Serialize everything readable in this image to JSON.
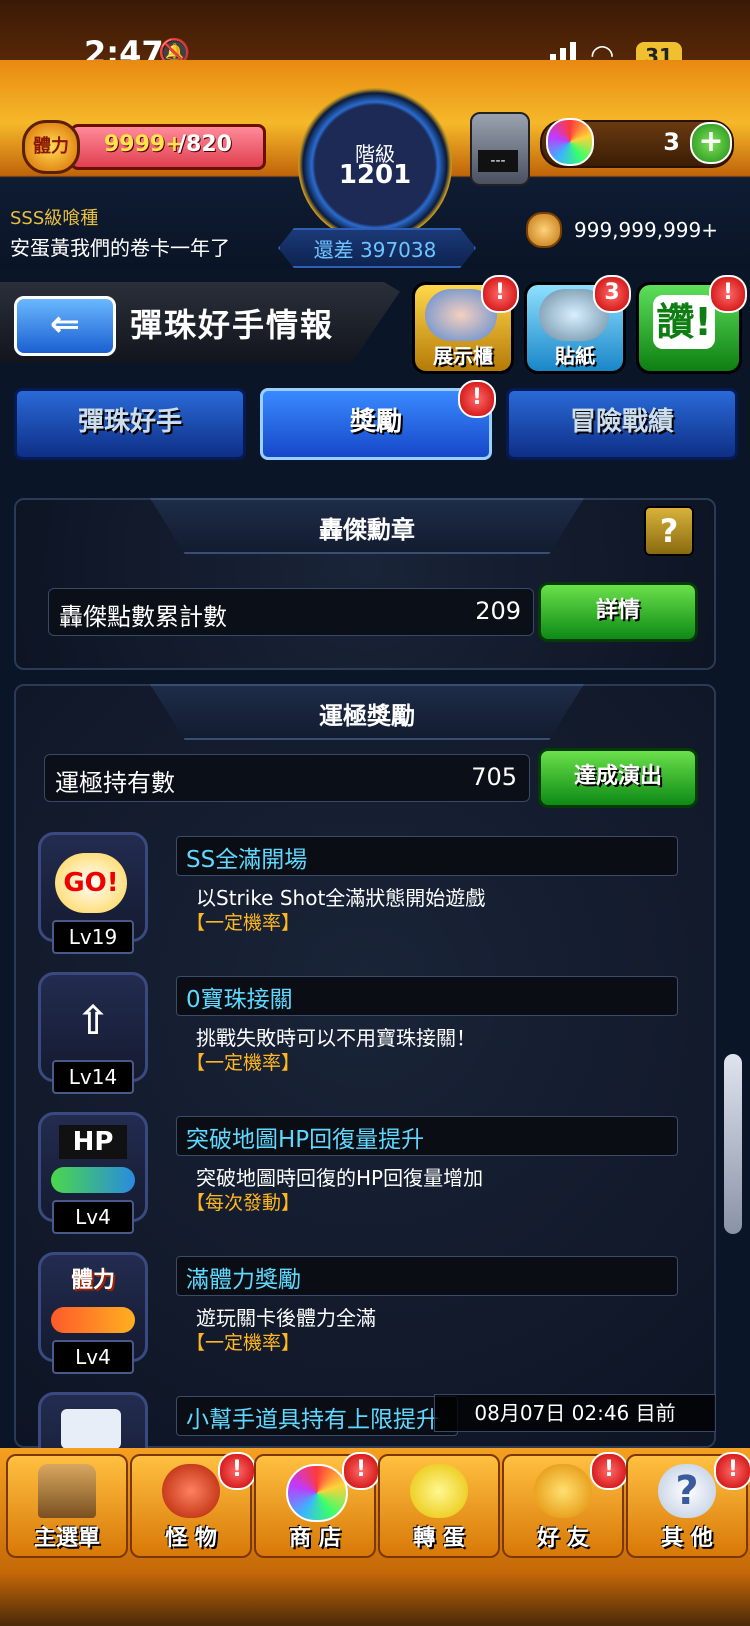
{
  "status_bar": {
    "time": "2:47",
    "battery": "31"
  },
  "header": {
    "stamina_icon_label": "體力",
    "stamina_current": "9999+",
    "stamina_max": "/820",
    "rank_label": "階級",
    "rank_value": "1201",
    "exp_remaining": "還差 397038",
    "gem_machine_label": "---",
    "orb_count": "3",
    "add_symbol": "+",
    "player_title": "SSS級喰種",
    "player_name": "安蛋黃我們的卷卡一年了",
    "coin_count": "999,999,999+"
  },
  "title_bar": {
    "back_symbol": "⇐",
    "title": "彈珠好手情報",
    "buttons": [
      {
        "label": "展示櫃",
        "badge": "!"
      },
      {
        "label": "貼紙",
        "badge": "3"
      },
      {
        "label": "讚!",
        "badge": "!"
      }
    ]
  },
  "tabs": [
    {
      "label": "彈珠好手"
    },
    {
      "label": "獎勵",
      "badge": "!"
    },
    {
      "label": "冒險戰績"
    }
  ],
  "medal_panel": {
    "title": "轟傑勳章",
    "help_symbol": "?",
    "row_label": "轟傑點數累計數",
    "row_value": "209",
    "button": "詳情"
  },
  "luck_panel": {
    "title": "運極獎勵",
    "row_label": "運極持有數",
    "row_value": "705",
    "button": "達成演出",
    "perks": [
      {
        "icon": "go-icon",
        "icon_text": "GO!",
        "level": "Lv19",
        "name": "SS全滿開場",
        "desc": "以Strike Shot全滿狀態開始遊戲",
        "tag": "【一定機率】"
      },
      {
        "icon": "wings-arrow-icon",
        "icon_text": "",
        "level": "Lv14",
        "name": "0寶珠接關",
        "desc": "挑戰失敗時可以不用寶珠接關！",
        "tag": "【一定機率】"
      },
      {
        "icon": "hp-icon",
        "icon_text": "HP",
        "level": "Lv4",
        "name": "突破地圖HP回復量提升",
        "desc": "突破地圖時回復的HP回復量增加",
        "tag": "【每次發動】"
      },
      {
        "icon": "stamina-icon",
        "icon_text": "體力",
        "level": "Lv4",
        "name": "滿體力獎勵",
        "desc": "遊玩關卡後體力全滿",
        "tag": "【一定機率】"
      },
      {
        "icon": "item-icon",
        "icon_text": "",
        "level": "",
        "name": "小幫手道具持有上限提升",
        "desc": "",
        "tag": ""
      }
    ]
  },
  "timestamp": "08月07日 02:46 目前",
  "bottom_nav": [
    {
      "label": "主選單",
      "badge": ""
    },
    {
      "label": "怪 物",
      "badge": "!"
    },
    {
      "label": "商 店",
      "badge": "!"
    },
    {
      "label": "轉 蛋",
      "badge": ""
    },
    {
      "label": "好 友",
      "badge": "!"
    },
    {
      "label": "其 他",
      "badge": "!"
    }
  ],
  "colors": {
    "accent_orange": "#f6a020",
    "tab_blue": "#1a5fd0",
    "green_button": "#0e8a16",
    "perk_name": "#5fd8ff",
    "perk_tag": "#ffb820"
  }
}
